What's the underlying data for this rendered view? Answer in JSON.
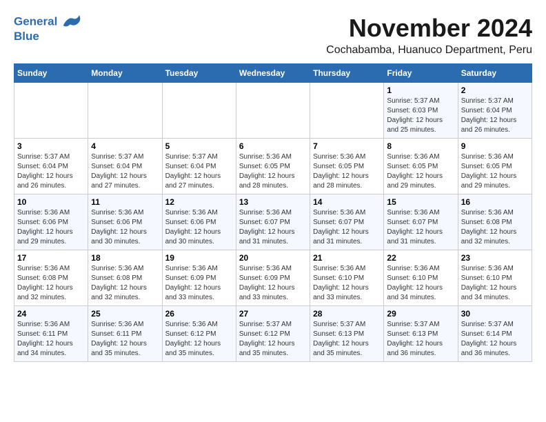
{
  "header": {
    "logo_line1": "General",
    "logo_line2": "Blue",
    "main_title": "November 2024",
    "subtitle": "Cochabamba, Huanuco Department, Peru"
  },
  "calendar": {
    "weekdays": [
      "Sunday",
      "Monday",
      "Tuesday",
      "Wednesday",
      "Thursday",
      "Friday",
      "Saturday"
    ],
    "rows": [
      [
        {
          "day": "",
          "info": ""
        },
        {
          "day": "",
          "info": ""
        },
        {
          "day": "",
          "info": ""
        },
        {
          "day": "",
          "info": ""
        },
        {
          "day": "",
          "info": ""
        },
        {
          "day": "1",
          "info": "Sunrise: 5:37 AM\nSunset: 6:03 PM\nDaylight: 12 hours and 25 minutes."
        },
        {
          "day": "2",
          "info": "Sunrise: 5:37 AM\nSunset: 6:04 PM\nDaylight: 12 hours and 26 minutes."
        }
      ],
      [
        {
          "day": "3",
          "info": "Sunrise: 5:37 AM\nSunset: 6:04 PM\nDaylight: 12 hours and 26 minutes."
        },
        {
          "day": "4",
          "info": "Sunrise: 5:37 AM\nSunset: 6:04 PM\nDaylight: 12 hours and 27 minutes."
        },
        {
          "day": "5",
          "info": "Sunrise: 5:37 AM\nSunset: 6:04 PM\nDaylight: 12 hours and 27 minutes."
        },
        {
          "day": "6",
          "info": "Sunrise: 5:36 AM\nSunset: 6:05 PM\nDaylight: 12 hours and 28 minutes."
        },
        {
          "day": "7",
          "info": "Sunrise: 5:36 AM\nSunset: 6:05 PM\nDaylight: 12 hours and 28 minutes."
        },
        {
          "day": "8",
          "info": "Sunrise: 5:36 AM\nSunset: 6:05 PM\nDaylight: 12 hours and 29 minutes."
        },
        {
          "day": "9",
          "info": "Sunrise: 5:36 AM\nSunset: 6:05 PM\nDaylight: 12 hours and 29 minutes."
        }
      ],
      [
        {
          "day": "10",
          "info": "Sunrise: 5:36 AM\nSunset: 6:06 PM\nDaylight: 12 hours and 29 minutes."
        },
        {
          "day": "11",
          "info": "Sunrise: 5:36 AM\nSunset: 6:06 PM\nDaylight: 12 hours and 30 minutes."
        },
        {
          "day": "12",
          "info": "Sunrise: 5:36 AM\nSunset: 6:06 PM\nDaylight: 12 hours and 30 minutes."
        },
        {
          "day": "13",
          "info": "Sunrise: 5:36 AM\nSunset: 6:07 PM\nDaylight: 12 hours and 31 minutes."
        },
        {
          "day": "14",
          "info": "Sunrise: 5:36 AM\nSunset: 6:07 PM\nDaylight: 12 hours and 31 minutes."
        },
        {
          "day": "15",
          "info": "Sunrise: 5:36 AM\nSunset: 6:07 PM\nDaylight: 12 hours and 31 minutes."
        },
        {
          "day": "16",
          "info": "Sunrise: 5:36 AM\nSunset: 6:08 PM\nDaylight: 12 hours and 32 minutes."
        }
      ],
      [
        {
          "day": "17",
          "info": "Sunrise: 5:36 AM\nSunset: 6:08 PM\nDaylight: 12 hours and 32 minutes."
        },
        {
          "day": "18",
          "info": "Sunrise: 5:36 AM\nSunset: 6:08 PM\nDaylight: 12 hours and 32 minutes."
        },
        {
          "day": "19",
          "info": "Sunrise: 5:36 AM\nSunset: 6:09 PM\nDaylight: 12 hours and 33 minutes."
        },
        {
          "day": "20",
          "info": "Sunrise: 5:36 AM\nSunset: 6:09 PM\nDaylight: 12 hours and 33 minutes."
        },
        {
          "day": "21",
          "info": "Sunrise: 5:36 AM\nSunset: 6:10 PM\nDaylight: 12 hours and 33 minutes."
        },
        {
          "day": "22",
          "info": "Sunrise: 5:36 AM\nSunset: 6:10 PM\nDaylight: 12 hours and 34 minutes."
        },
        {
          "day": "23",
          "info": "Sunrise: 5:36 AM\nSunset: 6:10 PM\nDaylight: 12 hours and 34 minutes."
        }
      ],
      [
        {
          "day": "24",
          "info": "Sunrise: 5:36 AM\nSunset: 6:11 PM\nDaylight: 12 hours and 34 minutes."
        },
        {
          "day": "25",
          "info": "Sunrise: 5:36 AM\nSunset: 6:11 PM\nDaylight: 12 hours and 35 minutes."
        },
        {
          "day": "26",
          "info": "Sunrise: 5:36 AM\nSunset: 6:12 PM\nDaylight: 12 hours and 35 minutes."
        },
        {
          "day": "27",
          "info": "Sunrise: 5:37 AM\nSunset: 6:12 PM\nDaylight: 12 hours and 35 minutes."
        },
        {
          "day": "28",
          "info": "Sunrise: 5:37 AM\nSunset: 6:13 PM\nDaylight: 12 hours and 35 minutes."
        },
        {
          "day": "29",
          "info": "Sunrise: 5:37 AM\nSunset: 6:13 PM\nDaylight: 12 hours and 36 minutes."
        },
        {
          "day": "30",
          "info": "Sunrise: 5:37 AM\nSunset: 6:14 PM\nDaylight: 12 hours and 36 minutes."
        }
      ]
    ]
  }
}
